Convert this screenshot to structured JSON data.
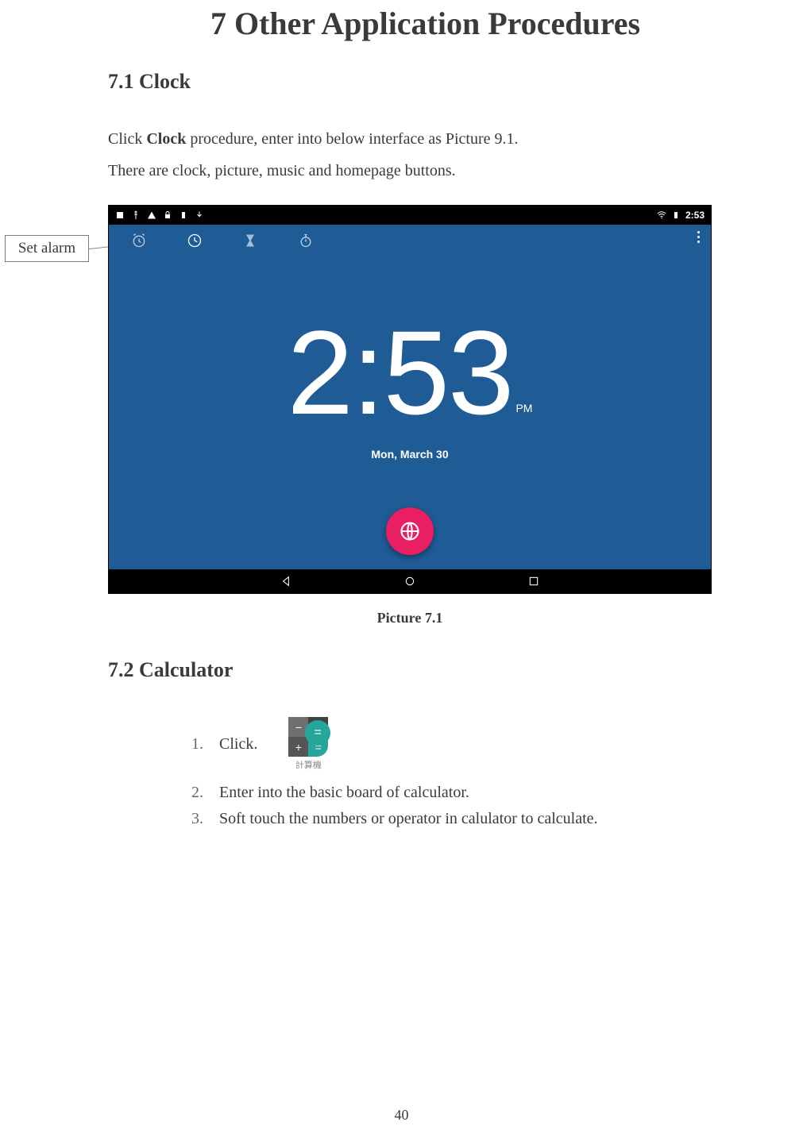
{
  "title": "7 Other Application Procedures",
  "section1": {
    "heading": "7.1 Clock",
    "p1_a": "Click ",
    "p1_b": "Clock",
    "p1_c": " procedure, enter into below interface as Picture 9.1.",
    "p2": "There are clock, picture, music and homepage buttons.",
    "caption": "Picture 7.1"
  },
  "callout": "Set alarm",
  "clock": {
    "status_time": "2:53",
    "time": "2:53",
    "ampm": "PM",
    "date": "Mon, March 30"
  },
  "section2": {
    "heading": "7.2 Calculator",
    "items": {
      "n1": "1.",
      "t1": "Click.",
      "n2": "2.",
      "t2": "Enter into the basic board of calculator.",
      "n3": "3.",
      "t3": "Soft touch the numbers or operator in calulator to calculate."
    },
    "icon_label": "計算機"
  },
  "page_number": "40"
}
